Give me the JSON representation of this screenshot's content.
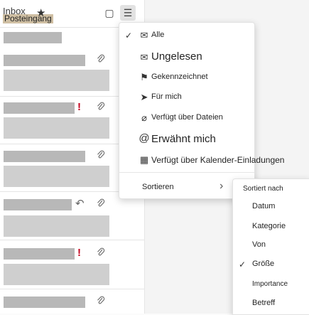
{
  "header": {
    "title": "Inbox",
    "subtitle": "Posteingang"
  },
  "icons": {
    "star": "★",
    "square": "▢",
    "filter": "☰",
    "clip": "⌂",
    "flag": "!",
    "reply": "↶",
    "check": "✓",
    "chevron": "›"
  },
  "filter_menu": {
    "items": [
      {
        "label": "Alle",
        "icon": "✉",
        "checked": true
      },
      {
        "label": "Ungelesen",
        "icon": "✉",
        "checked": false
      },
      {
        "label": "Gekennzeichnet",
        "icon": "⚑",
        "checked": false
      },
      {
        "label": "Für mich",
        "icon": "➤",
        "checked": false
      },
      {
        "label": "Verfügt über Dateien",
        "icon": "⌀",
        "checked": false
      },
      {
        "label": "Erwähnt mich",
        "icon": "@",
        "checked": false
      },
      {
        "label": "Verfügt über Kalender-Einladungen",
        "icon": "▦",
        "checked": false
      }
    ],
    "sort_label": "Sortieren"
  },
  "sort_menu": {
    "header": "Sortiert nach",
    "items": [
      {
        "label": "Datum",
        "checked": false
      },
      {
        "label": "Kategorie",
        "checked": false
      },
      {
        "label": "Von",
        "checked": false
      },
      {
        "label": "Größe",
        "checked": true
      },
      {
        "label": "Importance",
        "checked": false
      },
      {
        "label": "Betreff",
        "checked": false
      }
    ]
  }
}
